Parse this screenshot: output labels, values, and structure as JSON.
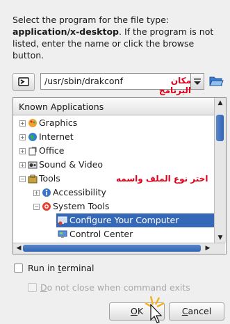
{
  "description": {
    "line1": "Select the program for the file type:",
    "mime": "application/x-desktop",
    "line2": ". If the program is not listed, enter the name or click the browse button."
  },
  "command": {
    "value": "/usr/sbin/drakconf",
    "annotation": "مكان البرنامج"
  },
  "tree": {
    "header": "Known Applications",
    "annotation": "اختر نوع الملف واسمه",
    "items": [
      {
        "label": "Graphics",
        "icon": "graphics-icon"
      },
      {
        "label": "Internet",
        "icon": "internet-globe-icon"
      },
      {
        "label": "Office",
        "icon": "office-icon"
      },
      {
        "label": "Sound & Video",
        "icon": "sound-video-icon"
      },
      {
        "label": "Tools",
        "icon": "tools-icon"
      },
      {
        "label": "Accessibility",
        "icon": "accessibility-icon"
      },
      {
        "label": "System Tools",
        "icon": "system-tools-icon"
      },
      {
        "label": "Configure Your Computer",
        "icon": "configure-computer-icon",
        "selected": true
      },
      {
        "label": "Control Center",
        "icon": "control-center-icon"
      }
    ]
  },
  "options": {
    "run_in_terminal_pre": "Run in ",
    "run_in_terminal_u": "t",
    "run_in_terminal_post": "erminal",
    "do_not_close_u": "D",
    "do_not_close_post": "o not close when command exits"
  },
  "buttons": {
    "ok_u": "O",
    "ok_post": "K",
    "cancel_u": "C",
    "cancel_post": "ancel"
  },
  "colors": {
    "selection": "#3569b7",
    "annotation": "#e0001b"
  }
}
